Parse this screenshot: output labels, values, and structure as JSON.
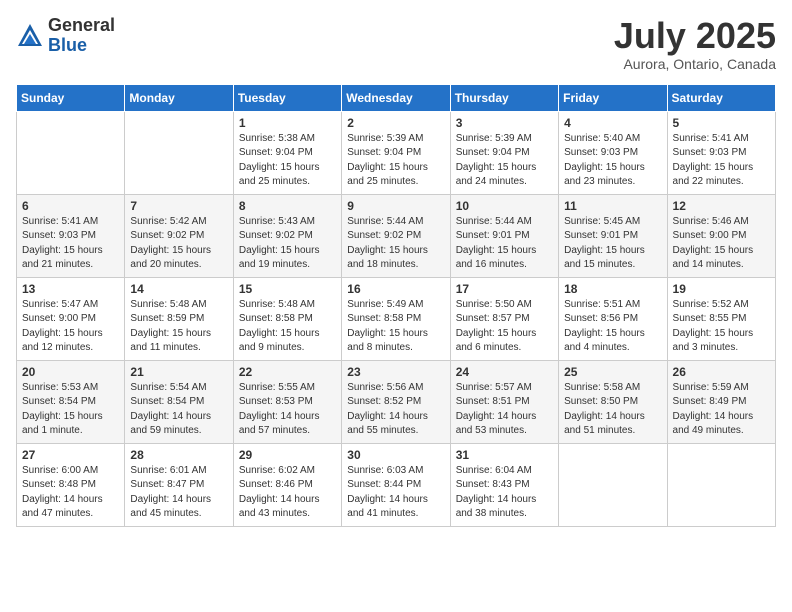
{
  "logo": {
    "general": "General",
    "blue": "Blue"
  },
  "title": "July 2025",
  "location": "Aurora, Ontario, Canada",
  "days_of_week": [
    "Sunday",
    "Monday",
    "Tuesday",
    "Wednesday",
    "Thursday",
    "Friday",
    "Saturday"
  ],
  "weeks": [
    [
      {
        "day": "",
        "sunrise": "",
        "sunset": "",
        "daylight": ""
      },
      {
        "day": "",
        "sunrise": "",
        "sunset": "",
        "daylight": ""
      },
      {
        "day": "1",
        "sunrise": "Sunrise: 5:38 AM",
        "sunset": "Sunset: 9:04 PM",
        "daylight": "Daylight: 15 hours and 25 minutes."
      },
      {
        "day": "2",
        "sunrise": "Sunrise: 5:39 AM",
        "sunset": "Sunset: 9:04 PM",
        "daylight": "Daylight: 15 hours and 25 minutes."
      },
      {
        "day": "3",
        "sunrise": "Sunrise: 5:39 AM",
        "sunset": "Sunset: 9:04 PM",
        "daylight": "Daylight: 15 hours and 24 minutes."
      },
      {
        "day": "4",
        "sunrise": "Sunrise: 5:40 AM",
        "sunset": "Sunset: 9:03 PM",
        "daylight": "Daylight: 15 hours and 23 minutes."
      },
      {
        "day": "5",
        "sunrise": "Sunrise: 5:41 AM",
        "sunset": "Sunset: 9:03 PM",
        "daylight": "Daylight: 15 hours and 22 minutes."
      }
    ],
    [
      {
        "day": "6",
        "sunrise": "Sunrise: 5:41 AM",
        "sunset": "Sunset: 9:03 PM",
        "daylight": "Daylight: 15 hours and 21 minutes."
      },
      {
        "day": "7",
        "sunrise": "Sunrise: 5:42 AM",
        "sunset": "Sunset: 9:02 PM",
        "daylight": "Daylight: 15 hours and 20 minutes."
      },
      {
        "day": "8",
        "sunrise": "Sunrise: 5:43 AM",
        "sunset": "Sunset: 9:02 PM",
        "daylight": "Daylight: 15 hours and 19 minutes."
      },
      {
        "day": "9",
        "sunrise": "Sunrise: 5:44 AM",
        "sunset": "Sunset: 9:02 PM",
        "daylight": "Daylight: 15 hours and 18 minutes."
      },
      {
        "day": "10",
        "sunrise": "Sunrise: 5:44 AM",
        "sunset": "Sunset: 9:01 PM",
        "daylight": "Daylight: 15 hours and 16 minutes."
      },
      {
        "day": "11",
        "sunrise": "Sunrise: 5:45 AM",
        "sunset": "Sunset: 9:01 PM",
        "daylight": "Daylight: 15 hours and 15 minutes."
      },
      {
        "day": "12",
        "sunrise": "Sunrise: 5:46 AM",
        "sunset": "Sunset: 9:00 PM",
        "daylight": "Daylight: 15 hours and 14 minutes."
      }
    ],
    [
      {
        "day": "13",
        "sunrise": "Sunrise: 5:47 AM",
        "sunset": "Sunset: 9:00 PM",
        "daylight": "Daylight: 15 hours and 12 minutes."
      },
      {
        "day": "14",
        "sunrise": "Sunrise: 5:48 AM",
        "sunset": "Sunset: 8:59 PM",
        "daylight": "Daylight: 15 hours and 11 minutes."
      },
      {
        "day": "15",
        "sunrise": "Sunrise: 5:48 AM",
        "sunset": "Sunset: 8:58 PM",
        "daylight": "Daylight: 15 hours and 9 minutes."
      },
      {
        "day": "16",
        "sunrise": "Sunrise: 5:49 AM",
        "sunset": "Sunset: 8:58 PM",
        "daylight": "Daylight: 15 hours and 8 minutes."
      },
      {
        "day": "17",
        "sunrise": "Sunrise: 5:50 AM",
        "sunset": "Sunset: 8:57 PM",
        "daylight": "Daylight: 15 hours and 6 minutes."
      },
      {
        "day": "18",
        "sunrise": "Sunrise: 5:51 AM",
        "sunset": "Sunset: 8:56 PM",
        "daylight": "Daylight: 15 hours and 4 minutes."
      },
      {
        "day": "19",
        "sunrise": "Sunrise: 5:52 AM",
        "sunset": "Sunset: 8:55 PM",
        "daylight": "Daylight: 15 hours and 3 minutes."
      }
    ],
    [
      {
        "day": "20",
        "sunrise": "Sunrise: 5:53 AM",
        "sunset": "Sunset: 8:54 PM",
        "daylight": "Daylight: 15 hours and 1 minute."
      },
      {
        "day": "21",
        "sunrise": "Sunrise: 5:54 AM",
        "sunset": "Sunset: 8:54 PM",
        "daylight": "Daylight: 14 hours and 59 minutes."
      },
      {
        "day": "22",
        "sunrise": "Sunrise: 5:55 AM",
        "sunset": "Sunset: 8:53 PM",
        "daylight": "Daylight: 14 hours and 57 minutes."
      },
      {
        "day": "23",
        "sunrise": "Sunrise: 5:56 AM",
        "sunset": "Sunset: 8:52 PM",
        "daylight": "Daylight: 14 hours and 55 minutes."
      },
      {
        "day": "24",
        "sunrise": "Sunrise: 5:57 AM",
        "sunset": "Sunset: 8:51 PM",
        "daylight": "Daylight: 14 hours and 53 minutes."
      },
      {
        "day": "25",
        "sunrise": "Sunrise: 5:58 AM",
        "sunset": "Sunset: 8:50 PM",
        "daylight": "Daylight: 14 hours and 51 minutes."
      },
      {
        "day": "26",
        "sunrise": "Sunrise: 5:59 AM",
        "sunset": "Sunset: 8:49 PM",
        "daylight": "Daylight: 14 hours and 49 minutes."
      }
    ],
    [
      {
        "day": "27",
        "sunrise": "Sunrise: 6:00 AM",
        "sunset": "Sunset: 8:48 PM",
        "daylight": "Daylight: 14 hours and 47 minutes."
      },
      {
        "day": "28",
        "sunrise": "Sunrise: 6:01 AM",
        "sunset": "Sunset: 8:47 PM",
        "daylight": "Daylight: 14 hours and 45 minutes."
      },
      {
        "day": "29",
        "sunrise": "Sunrise: 6:02 AM",
        "sunset": "Sunset: 8:46 PM",
        "daylight": "Daylight: 14 hours and 43 minutes."
      },
      {
        "day": "30",
        "sunrise": "Sunrise: 6:03 AM",
        "sunset": "Sunset: 8:44 PM",
        "daylight": "Daylight: 14 hours and 41 minutes."
      },
      {
        "day": "31",
        "sunrise": "Sunrise: 6:04 AM",
        "sunset": "Sunset: 8:43 PM",
        "daylight": "Daylight: 14 hours and 38 minutes."
      },
      {
        "day": "",
        "sunrise": "",
        "sunset": "",
        "daylight": ""
      },
      {
        "day": "",
        "sunrise": "",
        "sunset": "",
        "daylight": ""
      }
    ]
  ]
}
